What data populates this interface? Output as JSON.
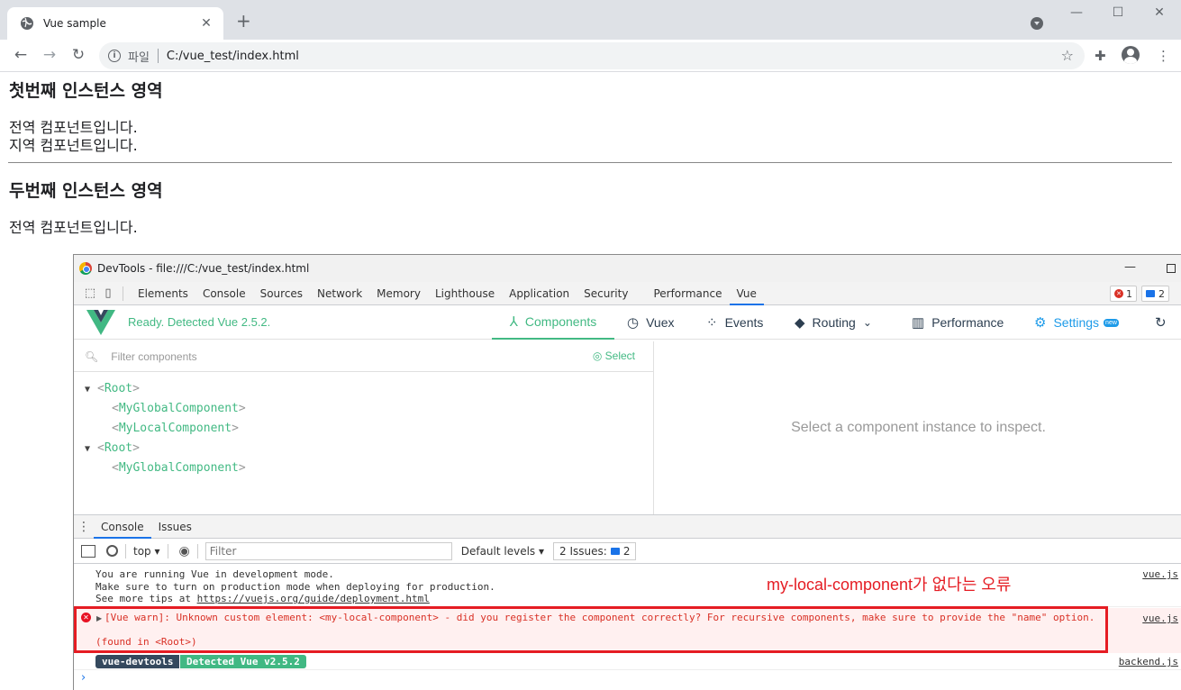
{
  "browser": {
    "tab_title": "Vue sample",
    "scheme_label": "파일",
    "url": "C:/vue_test/index.html"
  },
  "page": {
    "heading1": "첫번째 인스턴스 영역",
    "global_text": "전역 컴포넌트입니다.",
    "local_text": "지역 컴포넌트입니다.",
    "heading2": "두번째 인스턴스 영역",
    "global_text2": "전역 컴포넌트입니다."
  },
  "devtools": {
    "window_title": "DevTools - file:///C:/vue_test/index.html",
    "tabs": [
      "Elements",
      "Console",
      "Sources",
      "Network",
      "Memory",
      "Lighthouse",
      "Application",
      "Security",
      "Performance",
      "Vue"
    ],
    "active_tab": "Vue",
    "error_count": "1",
    "message_count": "2"
  },
  "vue": {
    "ready_text": "Ready. Detected Vue 2.5.2.",
    "nav": {
      "components": "Components",
      "vuex": "Vuex",
      "events": "Events",
      "routing": "Routing",
      "performance": "Performance",
      "settings": "Settings",
      "settings_badge": "new"
    },
    "filter_placeholder": "Filter components",
    "select_label": "Select",
    "tree": [
      {
        "name": "Root",
        "depth": 0
      },
      {
        "name": "MyGlobalComponent",
        "depth": 1
      },
      {
        "name": "MyLocalComponent",
        "depth": 1
      },
      {
        "name": "Root",
        "depth": 0
      },
      {
        "name": "MyGlobalComponent",
        "depth": 1
      }
    ],
    "inspect_hint": "Select a component instance to inspect."
  },
  "console": {
    "drawer_tabs": [
      "Console",
      "Issues"
    ],
    "context": "top",
    "filter_placeholder": "Filter",
    "levels": "Default levels",
    "issues_label": "2 Issues:",
    "issues_count": "2",
    "log_line1": "You are running Vue in development mode.",
    "log_line2": "Make sure to turn on production mode when deploying for production.",
    "log_line3_prefix": "See more tips at ",
    "log_line3_link": "https://vuejs.org/guide/deployment.html",
    "log_source": "vue.js",
    "warn_message": "[Vue warn]: Unknown custom element: <my-local-component> - did you register the component correctly? For recursive components, make sure to provide the \"name\" option.",
    "warn_found": "(found in <Root>)",
    "warn_source": "vue.js",
    "pill_left": "vue-devtools",
    "pill_right": "Detected Vue v2.5.2",
    "pill_source": "backend.js",
    "annotation": "my-local-component가 없다는 오류"
  }
}
